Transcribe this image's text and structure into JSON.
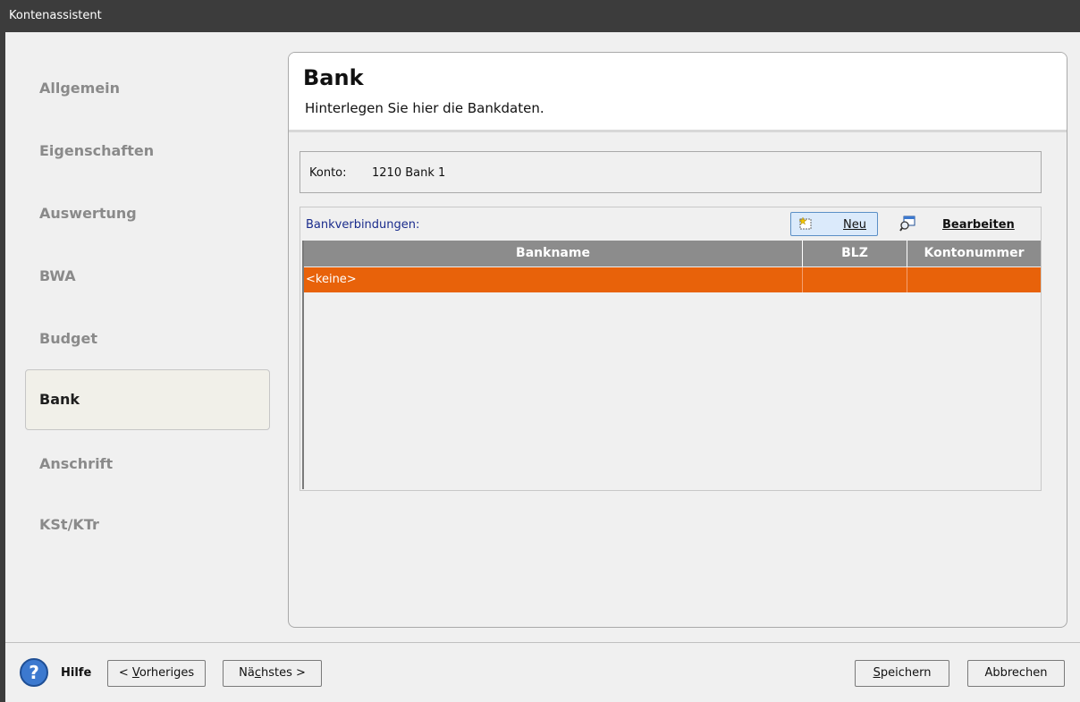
{
  "window": {
    "title": "Kontenassistent"
  },
  "nav": {
    "items": [
      {
        "label": "Allgemein",
        "active": false
      },
      {
        "label": "Eigenschaften",
        "active": false
      },
      {
        "label": "Auswertung",
        "active": false
      },
      {
        "label": "BWA",
        "active": false
      },
      {
        "label": "Budget",
        "active": false
      },
      {
        "label": "Bank",
        "active": true
      },
      {
        "label": "Anschrift",
        "active": false
      },
      {
        "label": "KSt/KTr",
        "active": false
      }
    ]
  },
  "panel": {
    "title": "Bank",
    "subtitle": "Hinterlegen Sie hier die Bankdaten.",
    "konto_label": "Konto:",
    "konto_value": "1210 Bank 1",
    "bank_section_label": "Bankverbindungen:",
    "toolbar": {
      "new_icon": "new-document-icon",
      "new_label": "Neu",
      "edit_icon": "edit-search-icon",
      "edit_label": "Bearbeiten"
    },
    "table": {
      "columns": [
        "Bankname",
        "BLZ",
        "Kontonummer"
      ],
      "rows": [
        {
          "bankname": "<keine>",
          "blz": "",
          "kontonummer": ""
        }
      ],
      "selected_row_color": "#e8620a"
    }
  },
  "footer": {
    "help_icon": "help-question-icon",
    "help_label": "Hilfe",
    "prev_prefix": "< ",
    "prev_key": "V",
    "prev_rest": "orheriges",
    "next_pre": "Nä",
    "next_key": "c",
    "next_rest": "hstes >",
    "save_key": "S",
    "save_rest": "peichern",
    "cancel_label": "Abbrechen"
  }
}
